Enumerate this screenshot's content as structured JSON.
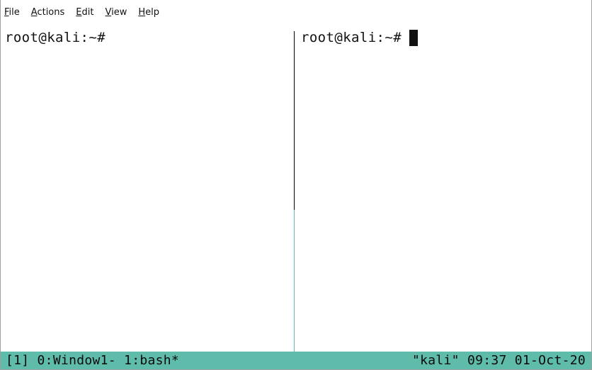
{
  "menu": {
    "file": {
      "mnemonic": "F",
      "rest": "ile"
    },
    "actions": {
      "mnemonic": "A",
      "rest": "ctions"
    },
    "edit": {
      "mnemonic": "E",
      "rest": "dit"
    },
    "view": {
      "mnemonic": "V",
      "rest": "iew"
    },
    "help": {
      "mnemonic": "H",
      "rest": "elp"
    }
  },
  "panes": {
    "left": {
      "prompt": "root@kali:~#"
    },
    "right": {
      "prompt": "root@kali:~#"
    }
  },
  "status": {
    "left": "[1] 0:Window1- 1:bash*",
    "right": "\"kali\" 09:37 01-Oct-20"
  },
  "colors": {
    "status_bar": "#5fbcaa",
    "active_divider": "#5fbcaa",
    "text": "#111111"
  }
}
